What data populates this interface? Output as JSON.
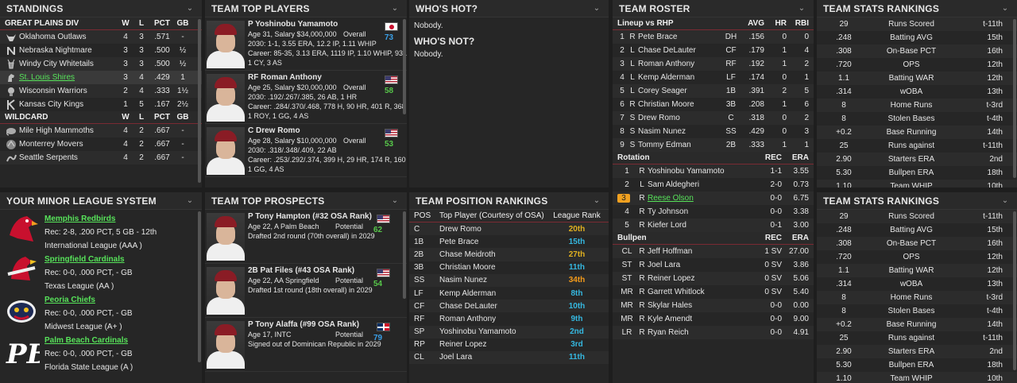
{
  "standings": {
    "title": "STANDINGS",
    "div_header": {
      "name": "GREAT PLAINS DIV",
      "w": "W",
      "l": "L",
      "pct": "PCT",
      "gb": "GB"
    },
    "div_rows": [
      {
        "team": "Oklahoma Outlaws",
        "w": "4",
        "l": "3",
        "pct": ".571",
        "gb": "-",
        "icon": "bull-icon"
      },
      {
        "team": "Nebraska Nightmare",
        "w": "3",
        "l": "3",
        "pct": ".500",
        "gb": "½",
        "icon": "n-logo-icon"
      },
      {
        "team": "Windy City Whitetails",
        "w": "3",
        "l": "3",
        "pct": ".500",
        "gb": "½",
        "icon": "deer-icon"
      },
      {
        "team": "St. Louis Shires",
        "w": "3",
        "l": "4",
        "pct": ".429",
        "gb": "1",
        "icon": "horse-icon",
        "highlight": true
      },
      {
        "team": "Wisconsin Warriors",
        "w": "2",
        "l": "4",
        "pct": ".333",
        "gb": "1½",
        "icon": "warrior-icon"
      },
      {
        "team": "Kansas City Kings",
        "w": "1",
        "l": "5",
        "pct": ".167",
        "gb": "2½",
        "icon": "k-logo-icon"
      }
    ],
    "wc_header": {
      "name": "WILDCARD",
      "w": "W",
      "l": "L",
      "pct": "PCT",
      "gb": "GB"
    },
    "wc_rows": [
      {
        "team": "Mile High Mammoths",
        "w": "4",
        "l": "2",
        "pct": ".667",
        "gb": "-",
        "icon": "mammoth-icon"
      },
      {
        "team": "Monterrey Movers",
        "w": "4",
        "l": "2",
        "pct": ".667",
        "gb": "-",
        "icon": "movers-icon"
      },
      {
        "team": "Seattle Serpents",
        "w": "4",
        "l": "2",
        "pct": ".667",
        "gb": "-",
        "icon": "serpent-icon"
      }
    ]
  },
  "top_players": {
    "title": "TEAM TOP PLAYERS",
    "overall_label": "Overall",
    "players": [
      {
        "name": "P Yoshinobu Yamamoto",
        "info": "Age 31, Salary $34,000,000",
        "overall": "73",
        "ovr_color": "#3aa0e8",
        "flag": "japan-flag-icon",
        "line1": "2030: 1-1, 3.55 ERA, 12.2 IP, 1.11 WHIP",
        "line2": "Career: 85-35, 3.13 ERA, 1119 IP, 1.10 WHIP, 931 K",
        "line3": "1 CY, 3 AS"
      },
      {
        "name": "RF Roman Anthony",
        "info": "Age 25, Salary $20,000,000",
        "overall": "58",
        "ovr_color": "#57c84a",
        "flag": "usa-flag-icon",
        "line1": "2030: .192/.267/.385, 26 AB, 1 HR",
        "line2": "Career: .284/.370/.468, 778 H, 90 HR, 401 R, 368 RB",
        "line3": "1 ROY, 1 GG, 4 AS"
      },
      {
        "name": "C Drew Romo",
        "info": "Age 28, Salary $10,000,000",
        "overall": "53",
        "ovr_color": "#57c84a",
        "flag": "usa-flag-icon",
        "line1": "2030: .318/.348/.409, 22 AB",
        "line2": "Career: .253/.292/.374, 399 H, 29 HR, 174 R, 160 RB",
        "line3": "1 GG, 4 AS"
      }
    ]
  },
  "whos_hot": {
    "title": "WHO'S HOT?",
    "text": "Nobody.",
    "not_title": "WHO'S NOT?",
    "not_text": "Nobody."
  },
  "roster": {
    "title": "TEAM ROSTER",
    "lineup_header": {
      "label": "Lineup vs RHP",
      "avg": "AVG",
      "hr": "HR",
      "rbi": "RBI"
    },
    "lineup": [
      {
        "n": "1",
        "h": "R",
        "name": "Pete Brace",
        "pos": "DH",
        "avg": ".156",
        "hr": "0",
        "rbi": "0"
      },
      {
        "n": "2",
        "h": "L",
        "name": "Chase DeLauter",
        "pos": "CF",
        "avg": ".179",
        "hr": "1",
        "rbi": "4"
      },
      {
        "n": "3",
        "h": "L",
        "name": "Roman Anthony",
        "pos": "RF",
        "avg": ".192",
        "hr": "1",
        "rbi": "2"
      },
      {
        "n": "4",
        "h": "L",
        "name": "Kemp Alderman",
        "pos": "LF",
        "avg": ".174",
        "hr": "0",
        "rbi": "1"
      },
      {
        "n": "5",
        "h": "L",
        "name": "Corey Seager",
        "pos": "1B",
        "avg": ".391",
        "hr": "2",
        "rbi": "5"
      },
      {
        "n": "6",
        "h": "R",
        "name": "Christian Moore",
        "pos": "3B",
        "avg": ".208",
        "hr": "1",
        "rbi": "6"
      },
      {
        "n": "7",
        "h": "S",
        "name": "Drew Romo",
        "pos": "C",
        "avg": ".318",
        "hr": "0",
        "rbi": "2"
      },
      {
        "n": "8",
        "h": "S",
        "name": "Nasim Nunez",
        "pos": "SS",
        "avg": ".429",
        "hr": "0",
        "rbi": "3"
      },
      {
        "n": "9",
        "h": "S",
        "name": "Tommy Edman",
        "pos": "2B",
        "avg": ".333",
        "hr": "1",
        "rbi": "1"
      }
    ],
    "rotation_header": {
      "label": "Rotation",
      "rec": "REC",
      "era": "ERA"
    },
    "rotation": [
      {
        "n": "1",
        "h": "R",
        "name": "Yoshinobu Yamamoto",
        "rec": "1-1",
        "era": "3.55"
      },
      {
        "n": "2",
        "h": "L",
        "name": "Sam Aldegheri",
        "rec": "2-0",
        "era": "0.73"
      },
      {
        "n": "3",
        "h": "R",
        "name": "Reese Olson",
        "rec": "0-0",
        "era": "6.75",
        "highlight": true
      },
      {
        "n": "4",
        "h": "R",
        "name": "Ty Johnson",
        "rec": "0-0",
        "era": "3.38"
      },
      {
        "n": "5",
        "h": "R",
        "name": "Kiefer Lord",
        "rec": "0-1",
        "era": "3.00"
      }
    ],
    "bullpen_header": {
      "label": "Bullpen",
      "rec": "REC",
      "era": "ERA"
    },
    "bullpen": [
      {
        "role": "CL",
        "h": "R",
        "name": "Jeff Hoffman",
        "rec": "1 SV",
        "era": "27.00"
      },
      {
        "role": "ST",
        "h": "R",
        "name": "Joel Lara",
        "rec": "0 SV",
        "era": "3.86"
      },
      {
        "role": "ST",
        "h": "R",
        "name": "Reiner Lopez",
        "rec": "0 SV",
        "era": "5.06"
      },
      {
        "role": "MR",
        "h": "R",
        "name": "Garrett Whitlock",
        "rec": "0 SV",
        "era": "5.40"
      },
      {
        "role": "MR",
        "h": "R",
        "name": "Skylar Hales",
        "rec": "0-0",
        "era": "0.00"
      },
      {
        "role": "MR",
        "h": "R",
        "name": "Kyle Amendt",
        "rec": "0-0",
        "era": "9.00"
      },
      {
        "role": "LR",
        "h": "R",
        "name": "Ryan Reich",
        "rec": "0-0",
        "era": "4.91"
      }
    ]
  },
  "stats_rankings": {
    "title": "TEAM STATS RANKINGS",
    "rows": [
      {
        "val": "29",
        "stat": "Runs Scored",
        "rank": "t-11th"
      },
      {
        "val": ".248",
        "stat": "Batting AVG",
        "rank": "15th"
      },
      {
        "val": ".308",
        "stat": "On-Base PCT",
        "rank": "16th"
      },
      {
        "val": ".720",
        "stat": "OPS",
        "rank": "12th"
      },
      {
        "val": "1.1",
        "stat": "Batting WAR",
        "rank": "12th"
      },
      {
        "val": ".314",
        "stat": "wOBA",
        "rank": "13th"
      },
      {
        "val": "8",
        "stat": "Home Runs",
        "rank": "t-3rd"
      },
      {
        "val": "8",
        "stat": "Stolen Bases",
        "rank": "t-4th"
      },
      {
        "val": "+0.2",
        "stat": "Base Running",
        "rank": "14th"
      },
      {
        "val": "25",
        "stat": "Runs against",
        "rank": "t-11th"
      },
      {
        "val": "2.90",
        "stat": "Starters ERA",
        "rank": "2nd"
      },
      {
        "val": "5.30",
        "stat": "Bullpen ERA",
        "rank": "18th"
      },
      {
        "val": "1.10",
        "stat": "Team WHIP",
        "rank": "10th"
      }
    ]
  },
  "minor_league": {
    "title": "YOUR MINOR LEAGUE SYSTEM",
    "teams": [
      {
        "name": "Memphis Redbirds",
        "rec": "Rec: 2-8, .200 PCT, 5 GB - 12th",
        "league": "International League (AAA )",
        "icon": "redbird-logo-icon"
      },
      {
        "name": "Springfield Cardinals",
        "rec": "Rec: 0-0, .000 PCT, - GB",
        "league": "Texas League (AA )",
        "icon": "cardinal-logo-icon"
      },
      {
        "name": "Peoria Chiefs",
        "rec": "Rec: 0-0, .000 PCT, - GB",
        "league": "Midwest League (A+ )",
        "icon": "chiefs-logo-icon"
      },
      {
        "name": "Palm Beach Cardinals",
        "rec": "Rec: 0-0, .000 PCT, - GB",
        "league": "Florida State League (A )",
        "icon": "pb-logo-icon"
      }
    ]
  },
  "top_prospects": {
    "title": "TEAM TOP PROSPECTS",
    "potential_label": "Potential",
    "prospects": [
      {
        "name": "P Tony Hampton (#32 OSA Rank)",
        "info": "Age 22, A Palm Beach",
        "potential": "62",
        "pot_color": "#57c84a",
        "flag": "usa-flag-icon",
        "line1": "Drafted 2nd round (70th overall) in 2029"
      },
      {
        "name": "2B Pat Files (#43 OSA Rank)",
        "info": "Age 22, AA Springfield",
        "potential": "54",
        "pot_color": "#57c84a",
        "flag": "usa-flag-icon",
        "line1": "Drafted 1st round (18th overall) in 2029"
      },
      {
        "name": "P Tony Alaffa (#99 OSA Rank)",
        "info": "Age 17, INTC",
        "potential": "79",
        "pot_color": "#3aa0e8",
        "flag": "dominican-flag-icon",
        "line1": "Signed out of Dominican Republic in 2029"
      }
    ]
  },
  "position_rankings": {
    "title": "TEAM POSITION RANKINGS",
    "header": {
      "pos": "POS",
      "player": "Top Player (Courtesy of OSA)",
      "rank": "League Rank"
    },
    "rows": [
      {
        "pos": "C",
        "player": "Drew Romo",
        "rank": "20th",
        "color": "#e0b020"
      },
      {
        "pos": "1B",
        "player": "Pete Brace",
        "rank": "15th",
        "color": "#35b8e0"
      },
      {
        "pos": "2B",
        "player": "Chase Meidroth",
        "rank": "27th",
        "color": "#e0b020"
      },
      {
        "pos": "3B",
        "player": "Christian Moore",
        "rank": "11th",
        "color": "#35b8e0"
      },
      {
        "pos": "SS",
        "player": "Nasim Nunez",
        "rank": "34th",
        "color": "#f39a1a"
      },
      {
        "pos": "LF",
        "player": "Kemp Alderman",
        "rank": "8th",
        "color": "#35b8e0"
      },
      {
        "pos": "CF",
        "player": "Chase DeLauter",
        "rank": "10th",
        "color": "#35b8e0"
      },
      {
        "pos": "RF",
        "player": "Roman Anthony",
        "rank": "9th",
        "color": "#35b8e0"
      },
      {
        "pos": "SP",
        "player": "Yoshinobu Yamamoto",
        "rank": "2nd",
        "color": "#35b8e0"
      },
      {
        "pos": "RP",
        "player": "Reiner Lopez",
        "rank": "3rd",
        "color": "#35b8e0"
      },
      {
        "pos": "CL",
        "player": "Joel Lara",
        "rank": "11th",
        "color": "#35b8e0"
      }
    ]
  }
}
